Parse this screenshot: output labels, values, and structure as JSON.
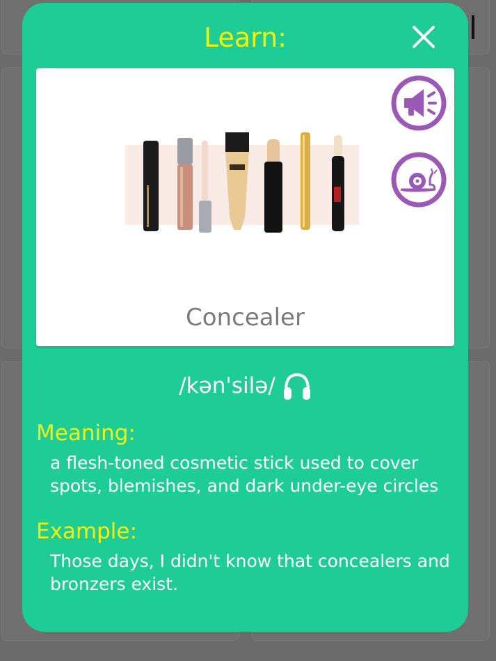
{
  "dialog": {
    "title": "Learn:",
    "close_icon": "close-icon"
  },
  "card": {
    "word": "Concealer",
    "image_icon": "concealer-products-image",
    "speak_button_icon": "megaphone-icon",
    "slow_speak_button_icon": "snail-icon"
  },
  "pronunciation": {
    "ipa": "/kən'silə/",
    "audio_icon": "headphones-icon"
  },
  "meaning": {
    "label": "Meaning:",
    "text": "a flesh-toned cosmetic stick used to cover spots, blemishes, and dark under-eye circles"
  },
  "example": {
    "label": "Example:",
    "text": "Those days, I didn't know that concealers and bronzers exist."
  },
  "colors": {
    "modal_bg": "#1ecc96",
    "title_yellow": "#f5f20a",
    "button_purple": "#9b59b6",
    "overlay": "#6b6b6b"
  }
}
